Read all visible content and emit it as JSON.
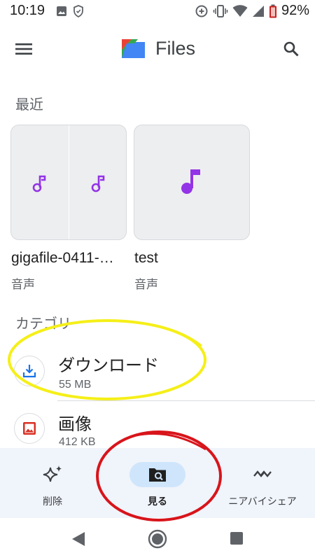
{
  "status_bar": {
    "time": "10:19",
    "battery": "92%"
  },
  "app_bar": {
    "title": "Files",
    "menu_icon": "menu-icon",
    "search_icon": "search-icon"
  },
  "recent": {
    "label": "最近",
    "items": [
      {
        "name": "gigafile-0411-…",
        "type": "音声",
        "icon": "music-note-icon"
      },
      {
        "name": "test",
        "type": "音声",
        "icon": "music-note-icon"
      }
    ]
  },
  "categories": {
    "label": "カテゴリ",
    "items": [
      {
        "name": "ダウンロード",
        "size": "55 MB",
        "icon": "download-icon"
      },
      {
        "name": "画像",
        "size": "412 KB",
        "icon": "image-icon"
      }
    ]
  },
  "bottom_nav": {
    "items": [
      {
        "label": "削除",
        "icon": "sparkle-icon",
        "active": false
      },
      {
        "label": "見る",
        "icon": "browse-icon",
        "active": true
      },
      {
        "label": "ニアバイシェア",
        "icon": "nearby-share-icon",
        "active": false
      }
    ]
  },
  "colors": {
    "accent": "#1a73e8",
    "music_purple": "#9334e6",
    "nav_active_bg": "#cfe5fb",
    "annotation_yellow": "#f5ef18",
    "annotation_red": "#d8141b"
  }
}
